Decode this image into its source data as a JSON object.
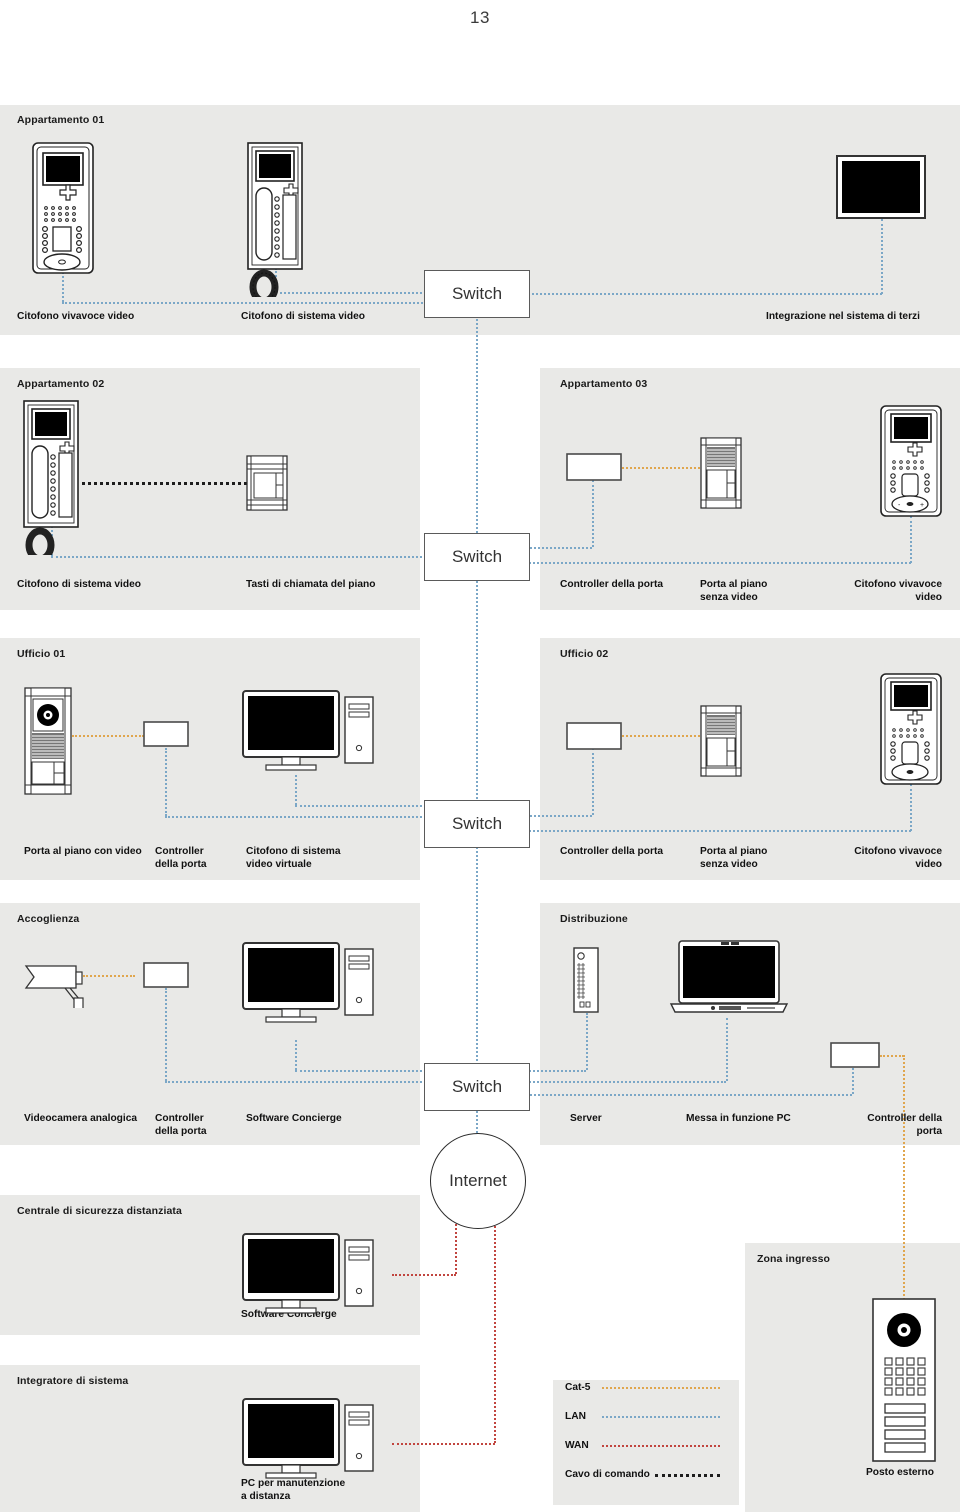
{
  "page": {
    "number": "13"
  },
  "nodes": {
    "switch_label": "Switch",
    "internet_label": "Internet"
  },
  "zones": [
    {
      "id": "appartamento-01",
      "title": "Appartamento 01",
      "devices": [
        {
          "name": "video-hands-free-intercom",
          "caption": "Citofono vivavoce video"
        },
        {
          "name": "video-system-intercom",
          "caption": "Citofono di sistema video"
        },
        {
          "name": "third-party-integration",
          "caption": "Integrazione nel sistema di terzi"
        }
      ]
    },
    {
      "id": "appartamento-02",
      "title": "Appartamento 02",
      "devices": [
        {
          "name": "video-system-intercom",
          "caption": "Citofono di sistema video"
        },
        {
          "name": "floor-call-buttons",
          "caption": "Tasti di chiamata del piano"
        }
      ]
    },
    {
      "id": "appartamento-03",
      "title": "Appartamento 03",
      "devices": [
        {
          "name": "door-controller",
          "caption": "Controller della porta"
        },
        {
          "name": "floor-door-without-video",
          "caption": "Porta al piano\nsenza video"
        },
        {
          "name": "video-hands-free-intercom",
          "caption": "Citofono vivavoce\nvideo"
        }
      ]
    },
    {
      "id": "ufficio-01",
      "title": "Ufficio 01",
      "devices": [
        {
          "name": "floor-door-with-video",
          "caption": "Porta al piano con video"
        },
        {
          "name": "door-controller",
          "caption": "Controller\ndella porta"
        },
        {
          "name": "virtual-video-intercom",
          "caption": "Citofono di sistema\nvideo virtuale"
        }
      ]
    },
    {
      "id": "ufficio-02",
      "title": "Ufficio 02",
      "devices": [
        {
          "name": "door-controller",
          "caption": "Controller della porta"
        },
        {
          "name": "floor-door-without-video",
          "caption": "Porta al piano\nsenza video"
        },
        {
          "name": "video-hands-free-intercom",
          "caption": "Citofono vivavoce\nvideo"
        }
      ]
    },
    {
      "id": "accoglienza",
      "title": "Accoglienza",
      "devices": [
        {
          "name": "analog-camera",
          "caption": "Videocamera analogica"
        },
        {
          "name": "door-controller",
          "caption": "Controller\ndella porta"
        },
        {
          "name": "concierge-software",
          "caption": "Software Concierge"
        }
      ]
    },
    {
      "id": "distribuzione",
      "title": "Distribuzione",
      "devices": [
        {
          "name": "server",
          "caption": "Server"
        },
        {
          "name": "commissioning-pc",
          "caption": "Messa in funzione PC"
        },
        {
          "name": "door-controller",
          "caption": "Controller della\nporta"
        }
      ]
    },
    {
      "id": "centrale-sicurezza",
      "title": "Centrale di sicurezza distanziata",
      "devices": [
        {
          "name": "concierge-software",
          "caption": "Software Concierge"
        }
      ]
    },
    {
      "id": "integratore-sistema",
      "title": "Integratore di sistema",
      "devices": [
        {
          "name": "remote-maintenance-pc",
          "caption": "PC per manutenzione\na distanza"
        }
      ]
    },
    {
      "id": "zona-ingresso",
      "title": "Zona ingresso",
      "devices": [
        {
          "name": "outdoor-station",
          "caption": "Posto esterno"
        }
      ]
    }
  ],
  "legend": {
    "items": [
      {
        "label": "Cat-5",
        "color": "#e0a64e"
      },
      {
        "label": "LAN",
        "color": "#7ba7c7"
      },
      {
        "label": "WAN",
        "color": "#c1453f"
      },
      {
        "label": "Cavo di comando",
        "color": "#1d1d1d"
      }
    ]
  },
  "colors": {
    "panel_bg": "#e9e9e7",
    "cat5": "#e0a64e",
    "lan": "#7ba7c7",
    "wan": "#c1453f",
    "control_cable": "#1d1d1d",
    "screen": "#000000"
  }
}
